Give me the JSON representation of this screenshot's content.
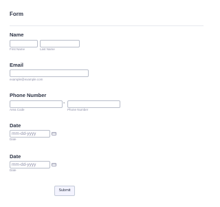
{
  "form": {
    "title": "Form"
  },
  "name": {
    "label": "Name",
    "first_value": "",
    "last_value": "",
    "first_sublabel": "First Name",
    "last_sublabel": "Last Name"
  },
  "email": {
    "label": "Email",
    "value": "",
    "sublabel": "example@example.com"
  },
  "phone": {
    "label": "Phone Number",
    "area_value": "",
    "number_value": "",
    "separator": "-",
    "area_sublabel": "Area Code",
    "number_sublabel": "Phone Number"
  },
  "date_1": {
    "label": "Date",
    "placeholder": "mm-dd-yyyy",
    "sublabel": "Date",
    "icon": "calendar-icon"
  },
  "date_2": {
    "label": "Date",
    "placeholder": "mm-dd-yyyy",
    "sublabel": "Date",
    "icon": "calendar-icon"
  },
  "actions": {
    "submit_label": "Submit"
  },
  "colors": {
    "text": "#2c3345",
    "sublabel": "#8d8fa8",
    "input_border": "#b8bdc9",
    "button_bg": "#f3f3fe"
  }
}
